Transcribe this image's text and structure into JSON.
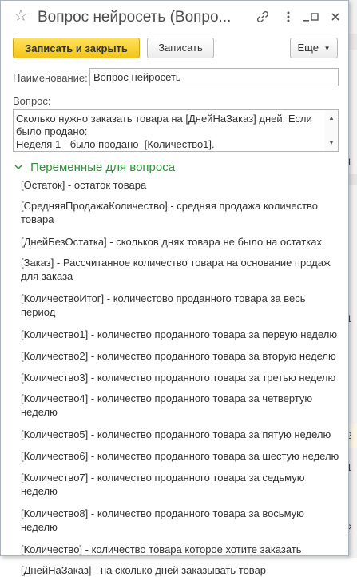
{
  "window": {
    "title": "Вопрос нейросеть (Вопро...",
    "star_icon": "star-icon",
    "link_icon": "link-icon",
    "menu_icon": "kebab-menu-icon",
    "minimize_icon": "minimize-icon",
    "maximize_icon": "maximize-icon",
    "close_icon": "close-icon"
  },
  "toolbar": {
    "save_close_label": "Записать и закрыть",
    "save_label": "Записать",
    "more_label": "Еще"
  },
  "form": {
    "name_label": "Наименование:",
    "name_value": "Вопрос нейросеть",
    "question_label": "Вопрос:",
    "question_value": "Сколько нужно заказать товара на [ДнейНаЗаказ] дней. Если было продано:\nНеделя 1 - было продано  [Количество1]."
  },
  "variables": {
    "header": "Переменные для вопроса",
    "items": [
      "[Остаток] - остаток товара",
      "[СредняяПродажаКоличество] - средняя продажа количество товара",
      "[ДнейБезОстатка] - скольков днях товара не было на остатках",
      "[Заказ] - Рассчитанное количество товара на основание продаж для заказа",
      "[КоличествоИтог] - количестово проданного товара за весь период",
      "[Количество1] - количество проданного товара за первую неделю",
      "[Количество2] - количество проданного товара за вторую неделю",
      "[Количество3] - количество проданного товара за третью неделю",
      "[Количество4] - количество проданного товара за четвертую неделю",
      "[Количество5] - количество проданного товара за пятую неделю",
      "[Количество6] - количество проданного товара за шестую неделю",
      "[Количество7] - количество проданного товара за седьмую неделю",
      "[Количество8] - количество проданного товара за восьмую неделю",
      "[Количество] - количество товара которое хотите заказать",
      "[ДнейНаЗаказ] - на сколько дней заказывать товар"
    ]
  },
  "background": {
    "strip_texts": [
      "1",
      "1",
      "2",
      "1",
      "2"
    ]
  },
  "colors": {
    "accent_green": "#2f8f3a",
    "primary_button": "#f5cd2b"
  }
}
